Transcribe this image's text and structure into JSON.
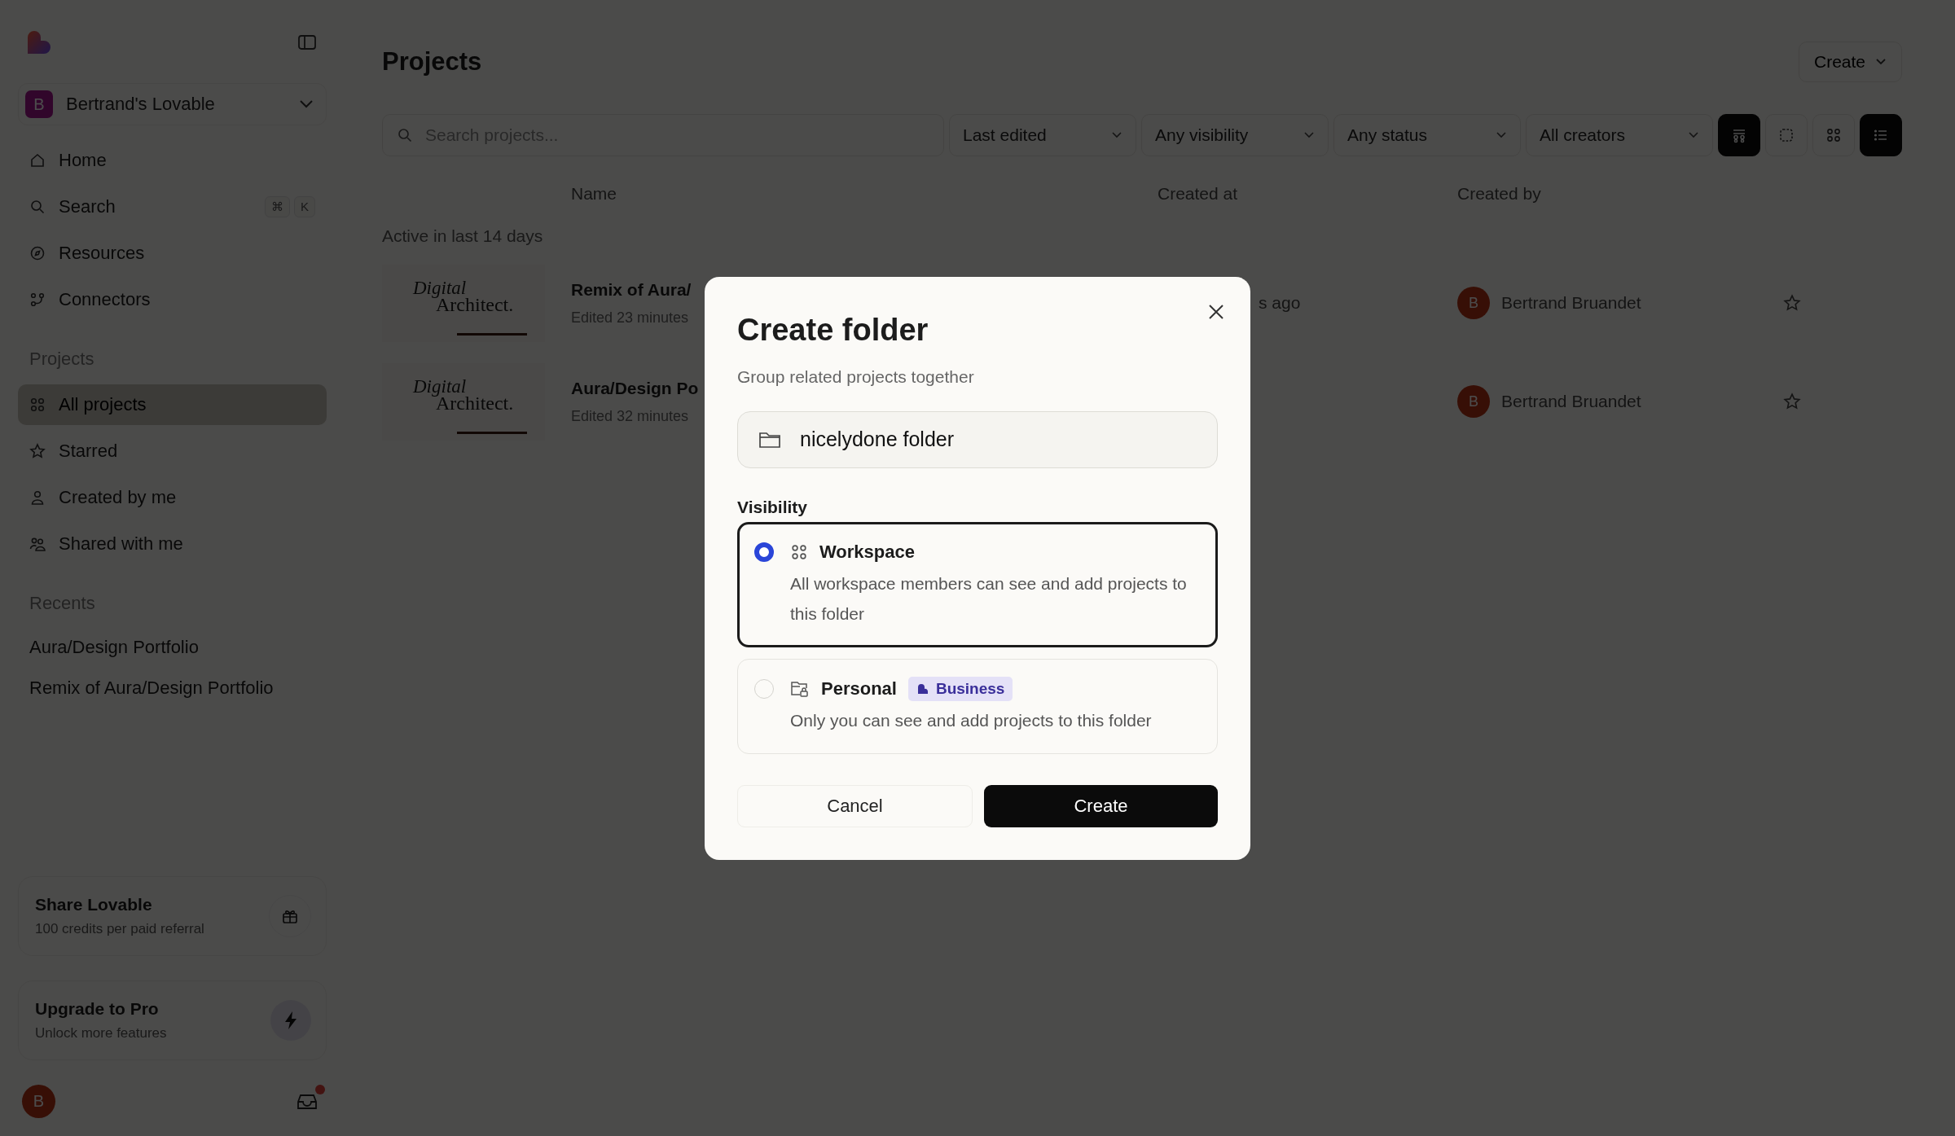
{
  "sidebar": {
    "workspace": {
      "initial": "B",
      "name": "Bertrand's Lovable"
    },
    "nav": [
      {
        "label": "Home",
        "selected": false
      },
      {
        "label": "Search",
        "selected": false,
        "shortcut": [
          "⌘",
          "K"
        ]
      },
      {
        "label": "Resources",
        "selected": false
      },
      {
        "label": "Connectors",
        "selected": false
      }
    ],
    "projects": {
      "title": "Projects",
      "items": [
        {
          "label": "All projects",
          "selected": true
        },
        {
          "label": "Starred",
          "selected": false
        },
        {
          "label": "Created by me",
          "selected": false
        },
        {
          "label": "Shared with me",
          "selected": false
        }
      ]
    },
    "recents": {
      "title": "Recents",
      "items": [
        {
          "label": "Aura/Design Portfolio"
        },
        {
          "label": "Remix of Aura/Design Portfolio"
        }
      ]
    },
    "share_card": {
      "title": "Share Lovable",
      "subtitle": "100 credits per paid referral"
    },
    "upgrade_card": {
      "title": "Upgrade to Pro",
      "subtitle": "Unlock more features"
    },
    "user": {
      "initial": "B",
      "has_notification": true
    }
  },
  "main": {
    "title": "Projects",
    "create_button": "Create",
    "search": {
      "placeholder": "Search projects..."
    },
    "filters": [
      {
        "label": "Last edited"
      },
      {
        "label": "Any visibility"
      },
      {
        "label": "Any status"
      },
      {
        "label": "All creators"
      }
    ],
    "view_toggle": {
      "on": true
    },
    "view_modes": [
      {
        "selected": false
      },
      {
        "selected": false
      },
      {
        "selected": true
      }
    ],
    "columns": [
      "Name",
      "Created at",
      "Created by"
    ],
    "group": "Active in last 14 days",
    "rows": [
      {
        "thumbnail": {
          "line_1": "Digital",
          "line_2": "Architect."
        },
        "name": "Remix of Aura/",
        "edited": "Edited 23 minutes",
        "created_at": "s ago",
        "creator": {
          "initial": "B",
          "name": "Bertrand Bruandet"
        },
        "starred": false
      },
      {
        "thumbnail": {
          "line_1": "Digital",
          "line_2": "Architect."
        },
        "name": "Aura/Design Po",
        "edited": "Edited 32 minutes",
        "creator": {
          "initial": "B",
          "name": "Bertrand Bruandet"
        },
        "starred": false
      }
    ]
  },
  "dialog": {
    "title": "Create folder",
    "subtitle": "Group related projects together",
    "field": {
      "value": "nicelydone folder"
    },
    "visibility_label": "Visibility",
    "options": [
      {
        "kind": "workspace",
        "title": "Workspace",
        "description": "All workspace members can see and add projects to this folder",
        "selected": true
      },
      {
        "kind": "personal",
        "title": "Personal",
        "badge": "Business",
        "description": "Only you can see and add projects to this folder",
        "selected": false
      }
    ],
    "cancel": "Cancel",
    "confirm": "Create"
  }
}
